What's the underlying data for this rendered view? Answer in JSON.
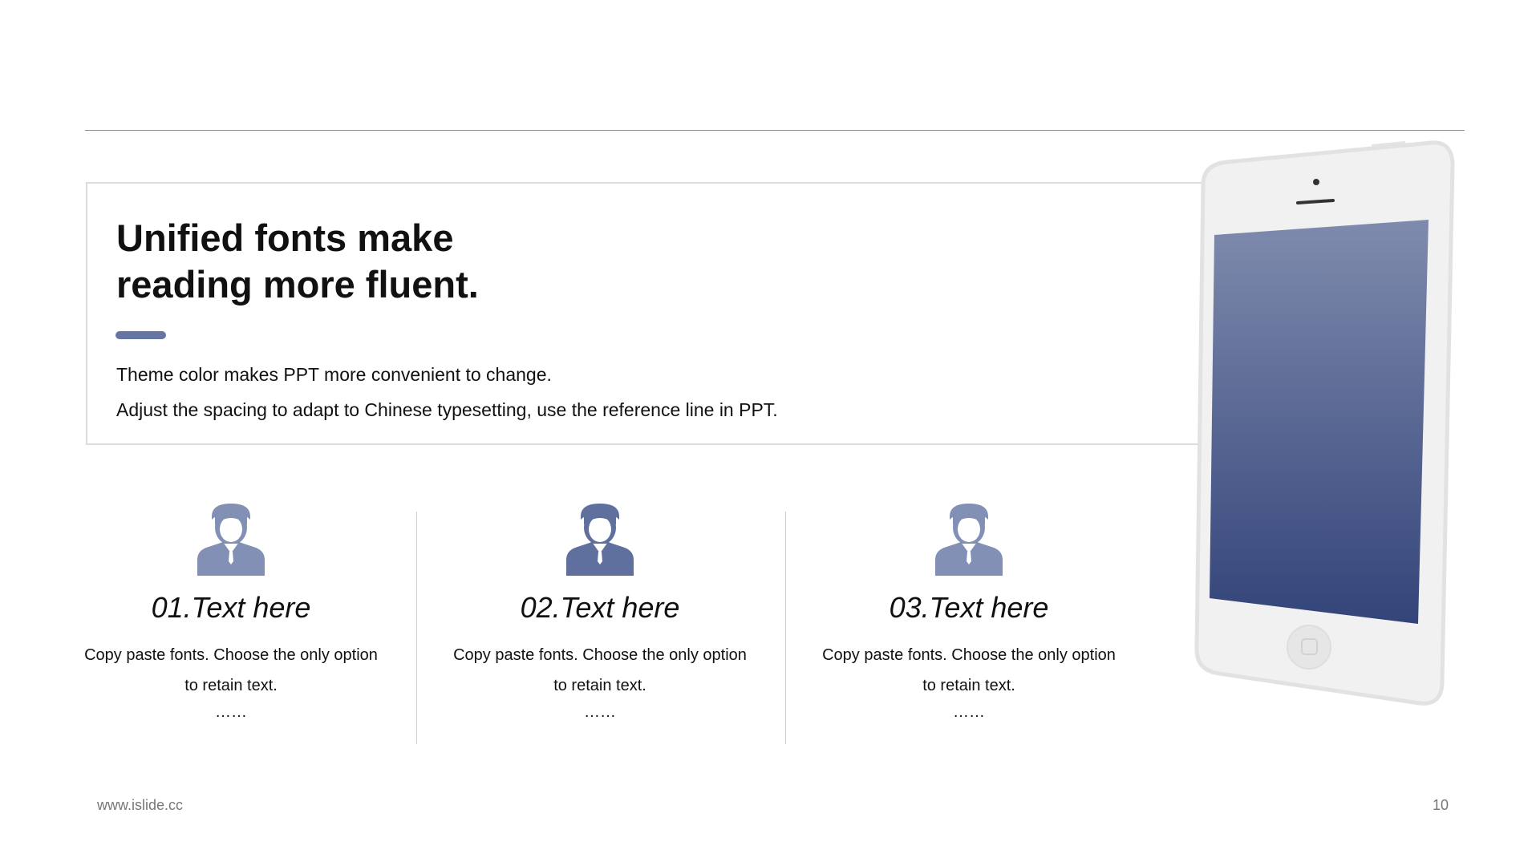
{
  "hero": {
    "title_line1": "Unified fonts make",
    "title_line2": "reading more fluent.",
    "line1": "Theme color makes PPT more convenient to change.",
    "line2": "Adjust the spacing to adapt to Chinese typesetting, use the reference line in PPT."
  },
  "columns": [
    {
      "icon": "person-icon",
      "title": "01.Text here",
      "desc": "Copy paste fonts. Choose the only option to retain text.",
      "dots": "……"
    },
    {
      "icon": "person-icon",
      "title": "02.Text here",
      "desc": "Copy paste fonts. Choose the only option to retain text.",
      "dots": "……"
    },
    {
      "icon": "person-icon",
      "title": "03.Text here",
      "desc": "Copy paste fonts. Choose the only option to retain text.",
      "dots": "……"
    }
  ],
  "footer": {
    "url": "www.islide.cc",
    "page": "10"
  },
  "colors": {
    "accent": "#6576a5",
    "icon_light": "#8290b6",
    "icon_dark": "#5f6f9e",
    "screen_top": "#7f8bad",
    "screen_bottom": "#334479"
  }
}
